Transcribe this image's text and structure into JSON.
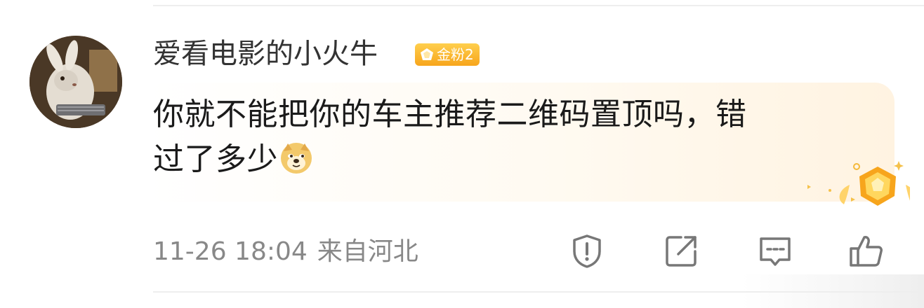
{
  "comment": {
    "username": "爱看电影的小火牛",
    "badge": {
      "label": "金粉2",
      "colors": {
        "from": "#ffcf4d",
        "to": "#f7a51c"
      }
    },
    "avatar": {
      "description_icon": "hooded-rabbit-avatar"
    },
    "text_line1": "你就不能把你的车主推荐二维码置顶吗，错",
    "text_line2": "过了多少",
    "emoji_icon": "doge-emoji-icon",
    "timestamp": "11-26 18:04",
    "location": "来自河北",
    "actions": [
      {
        "name": "report-icon"
      },
      {
        "name": "share-icon"
      },
      {
        "name": "comment-icon"
      },
      {
        "name": "like-icon"
      }
    ]
  },
  "colors": {
    "username": "#333333",
    "text": "#1a1a1a",
    "meta": "#888888",
    "icon": "#777777"
  }
}
